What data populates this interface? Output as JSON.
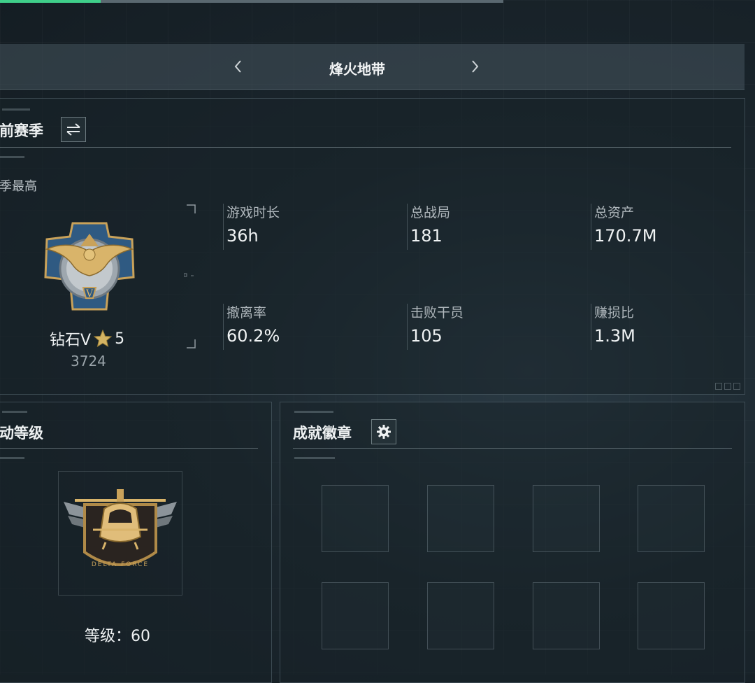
{
  "top_progress": {
    "fraction": 0.2
  },
  "nav": {
    "title": "烽火地带"
  },
  "season": {
    "title": "前赛季",
    "subtitle": "季最高",
    "rank_name": "钻石V",
    "rank_stars": "5",
    "rank_score": "3724",
    "stats": [
      {
        "label": "游戏时长",
        "value": "36h"
      },
      {
        "label": "总战局",
        "value": "181"
      },
      {
        "label": "总资产",
        "value": "170.7M"
      },
      {
        "label": "撤离率",
        "value": "60.2%"
      },
      {
        "label": "击败干员",
        "value": "105"
      },
      {
        "label": "赚损比",
        "value": "1.3M"
      }
    ]
  },
  "level_panel": {
    "title": "动等级",
    "level_label": "等级：60",
    "badge_text": "DELTA FORCE"
  },
  "achievements": {
    "title": "成就徽章",
    "slot_count": 8
  },
  "colors": {
    "accent_green": "#3fcf8a",
    "gold": "#c9a25a",
    "star": "#d4b463"
  }
}
